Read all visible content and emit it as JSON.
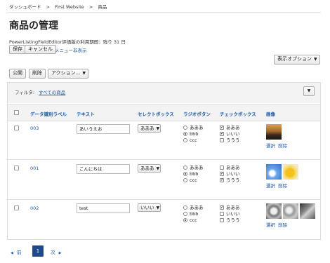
{
  "breadcrumb": {
    "item1": "ダッシュボード",
    "sep": ">",
    "item2": "First Website",
    "item3": "商品"
  },
  "page_title": "商品の管理",
  "trial_notice": "PowerListingFieldEditor評価版の利用期間：残り 31 日",
  "buttons": {
    "save": "保存",
    "cancel": "キャンセル",
    "menu_hide": "メニュー非表示",
    "display_options": "表示オプション",
    "publish": "公開",
    "delete": "削除",
    "actions": "アクション..."
  },
  "filter": {
    "label": "フィルタ:",
    "value": "すべての商品"
  },
  "columns": {
    "id_label": "データ識別ラベル",
    "text": "テキスト",
    "select": "セレクトボックス",
    "radio": "ラジオボタン",
    "checkbox": "チェックボックス",
    "image": "画像"
  },
  "option_labels": [
    "あああ",
    "bbb",
    "ccc"
  ],
  "checkbox_labels": [
    "あああ",
    "いいい",
    "ううう"
  ],
  "image_actions": {
    "select": "選択",
    "delete": "削除"
  },
  "rows": [
    {
      "id": "003",
      "text": "あいうえお",
      "select": "あああ",
      "radio_selected": 1,
      "checks": [
        true,
        true,
        false
      ]
    },
    {
      "id": "001",
      "text": "こんにちは",
      "select": "あああ",
      "radio_selected": 1,
      "checks": [
        false,
        true,
        true
      ]
    },
    {
      "id": "002",
      "text": "test",
      "select": "いいい",
      "radio_selected": 2,
      "checks": [
        true,
        false,
        false
      ]
    }
  ],
  "pagination": {
    "prev": "前",
    "current": "1",
    "next": "次"
  },
  "colors": {
    "link": "#1e5aa8",
    "header_bg": "#f3f3f3",
    "page_active": "#1e4a86"
  }
}
